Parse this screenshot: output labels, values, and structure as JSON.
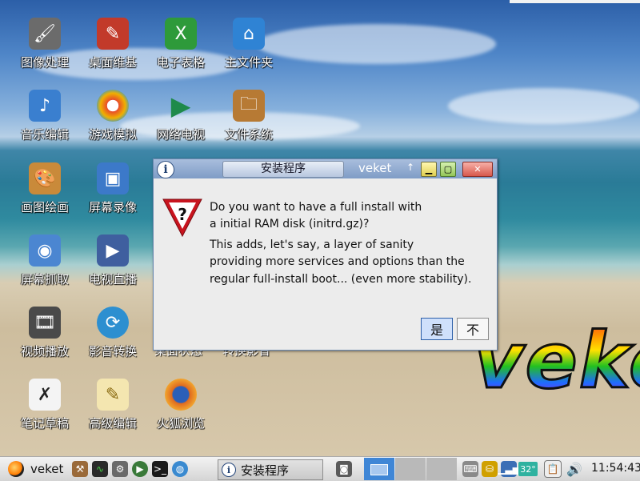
{
  "desktop": {
    "icons": [
      {
        "label": "图像处理",
        "icon": "gimp-icon",
        "color": "#6b6b6b"
      },
      {
        "label": "桌面维基",
        "icon": "wiki-icon",
        "color": "#c23a2a"
      },
      {
        "label": "电子表格",
        "icon": "spreadsheet-icon",
        "color": "#2e9a3a"
      },
      {
        "label": "主文件夹",
        "icon": "home-folder-icon",
        "color": "#2f83d4"
      },
      {
        "label": "音乐编辑",
        "icon": "music-editor-icon",
        "color": "#3a7fcf"
      },
      {
        "label": "游戏模拟",
        "icon": "game-emulator-icon",
        "color": "#e84b2b"
      },
      {
        "label": "网络电视",
        "icon": "play-icon",
        "color": "#2a8a5a"
      },
      {
        "label": "文件系统",
        "icon": "file-system-icon",
        "color": "#b77a34"
      },
      {
        "label": "画图绘画",
        "icon": "paint-palette-icon",
        "color": "#c98a3a"
      },
      {
        "label": "屏幕录像",
        "icon": "screen-recorder-icon",
        "color": "#3c79c9"
      },
      {
        "label": "屏幕抓取",
        "icon": "screenshot-icon",
        "color": "#4b86d1"
      },
      {
        "label": "电视直播",
        "icon": "tv-live-icon",
        "color": "#3f5f9f"
      },
      {
        "label": "视频播放",
        "icon": "video-player-icon",
        "color": "#4a4a4a"
      },
      {
        "label": "影音转换",
        "icon": "media-convert-icon",
        "color": "#2d8fd0"
      },
      {
        "label": "笔记草稿",
        "icon": "notes-icon",
        "color": "#555555"
      },
      {
        "label": "高级编辑",
        "icon": "text-editor-icon",
        "color": "#d0a23a"
      },
      {
        "label": "火狐浏览",
        "icon": "firefox-icon",
        "color": "#e06b1f"
      }
    ],
    "partial_labels": [
      "桌面状态",
      "转换影音"
    ],
    "logo_text": "veke"
  },
  "dialog": {
    "tab_title": "安装程序",
    "app_name": "veket",
    "up_arrow": "↑",
    "close_glyph": "✕",
    "line1": "Do you want to have a full install with",
    "line2": "a initial RAM disk (initrd.gz)?",
    "line3": "This adds, let's say, a layer of sanity",
    "line4": "providing more services and options than the",
    "line5": "regular full-install boot... (even more stability).",
    "yes_label": "是",
    "no_label": "不"
  },
  "taskbar": {
    "menu_label": "veket",
    "task_label": "安装程序",
    "temperature": "32°",
    "clock": "11:54:43"
  }
}
